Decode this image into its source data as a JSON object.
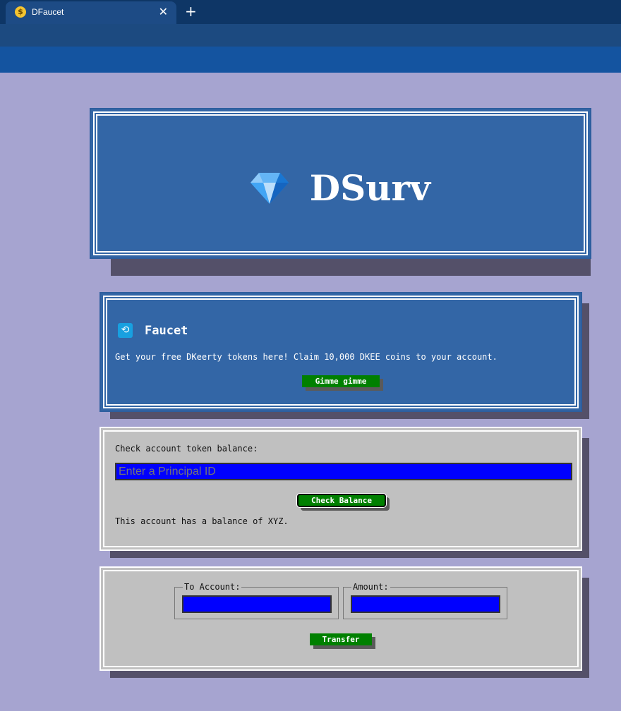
{
  "browser": {
    "tab_title": "DFaucet",
    "close_glyph": "✕",
    "new_tab_glyph": "+",
    "favicon": "money-face-icon"
  },
  "header": {
    "logo_icon": "diamond-icon",
    "title": "DSurv"
  },
  "faucet": {
    "icon": "faucet-icon",
    "title": "Faucet",
    "description": "Get your free DKeerty tokens here! Claim 10,000 DKEE coins to your account.",
    "button_label": "Gimme gimme"
  },
  "balance": {
    "label": "Check account token balance:",
    "input_placeholder": "Enter a Principal ID",
    "button_label": "Check Balance",
    "result_text": "This account has a balance of XYZ."
  },
  "transfer": {
    "to_label": "To Account:",
    "amount_label": "Amount:",
    "button_label": "Transfer"
  },
  "colors": {
    "page_bg": "#a6a4d0",
    "panel_blue": "#3366a6",
    "panel_grey": "#c0c0c0",
    "button_green": "#008000",
    "input_blue": "#0000ff"
  }
}
